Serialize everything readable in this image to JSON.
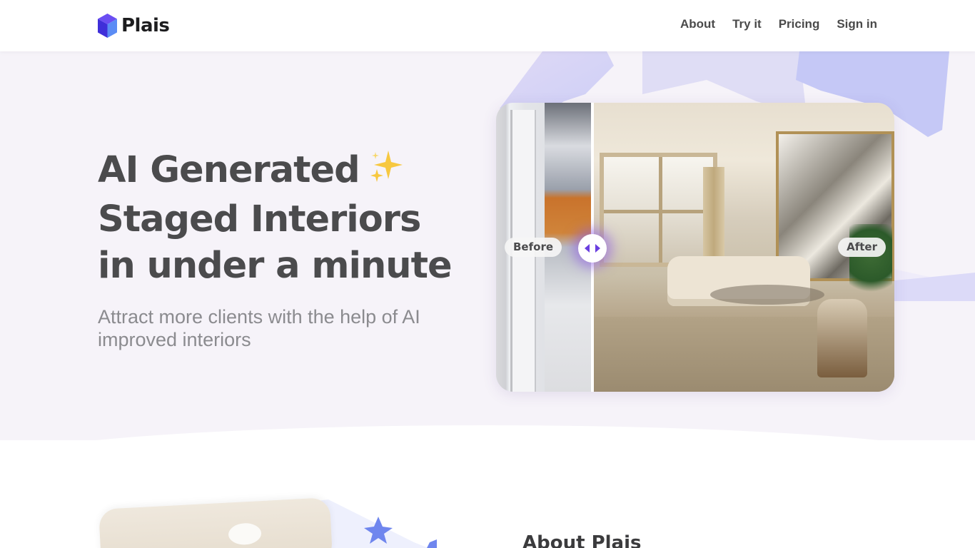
{
  "brand": {
    "name": "Plais",
    "logo_icon": "cube-icon"
  },
  "nav": {
    "links": [
      "About",
      "Try it",
      "Pricing",
      "Sign in"
    ]
  },
  "hero": {
    "headline_lines": [
      "AI Generated",
      "Staged Interiors",
      "in under a minute"
    ],
    "headline_emoji": "sparkles-icon",
    "subheadline": "Attract more clients with the help of AI improved interiors"
  },
  "comparison": {
    "before_label": "Before",
    "after_label": "After",
    "slider_position": 0.24
  },
  "about": {
    "title": "About Plais"
  },
  "colors": {
    "accent": "#6a3fe0",
    "hero_bg": "#f6f3f9",
    "decor": "#c9c6f4",
    "text": "#4b4b4d"
  }
}
